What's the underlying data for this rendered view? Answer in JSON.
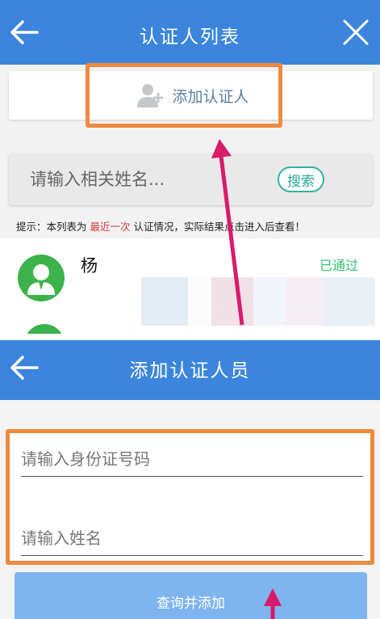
{
  "list_screen": {
    "title": "认证人列表",
    "back_icon": "back-arrow-icon",
    "close_icon": "close-icon",
    "add_button_label": "添加认证人",
    "add_button_icon": "add-user-icon",
    "search": {
      "placeholder": "请输入相关姓名...",
      "button_label": "搜索"
    },
    "tip": {
      "prefix": "提示：本列表为 ",
      "highlight": "最近一次",
      "suffix": " 认证情况，实际结果点击进入后查看！"
    },
    "person": {
      "name": "杨",
      "status": "已通过"
    }
  },
  "add_screen": {
    "title": "添加认证人员",
    "back_icon": "back-arrow-icon",
    "id_field_placeholder": "请输入身份证号码",
    "name_field_placeholder": "请输入姓名",
    "submit_label": "查询并添加"
  },
  "colors": {
    "header": "#3b86dc",
    "highlight_box": "#ef8a3e",
    "annotation_arrow": "#d81b6a",
    "status_green": "#33c06e",
    "submit_button": "#7fb4ef"
  }
}
